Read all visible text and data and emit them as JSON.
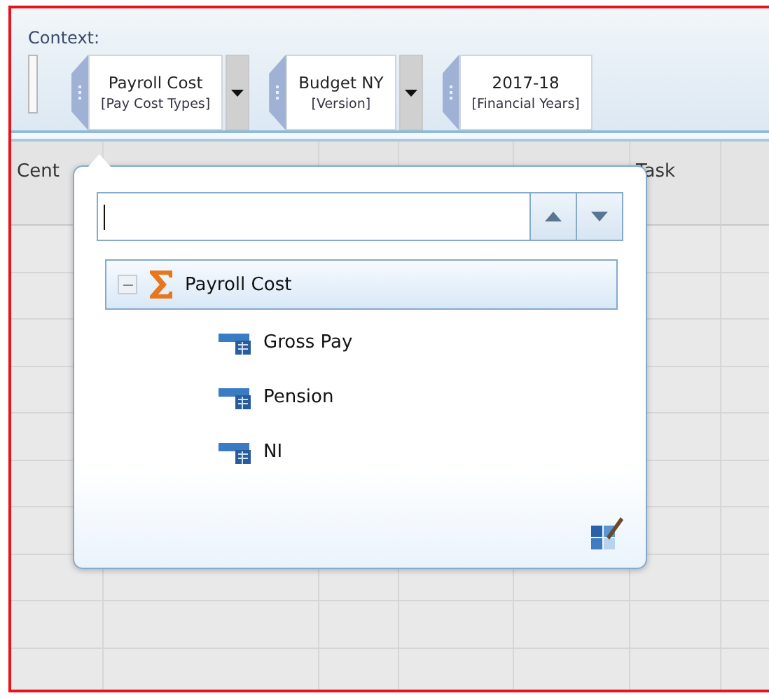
{
  "context": {
    "label": "Context:",
    "selectors": [
      {
        "value": "Payroll Cost",
        "dimension": "[Pay Cost Types]",
        "has_dropdown": true
      },
      {
        "value": "Budget NY",
        "dimension": "[Version]",
        "has_dropdown": true
      },
      {
        "value": "2017-18",
        "dimension": "[Financial Years]",
        "has_dropdown": false
      }
    ]
  },
  "grid": {
    "columns": [
      {
        "label": "Cent"
      },
      {},
      {},
      {},
      {},
      {
        "label": "Task"
      },
      {}
    ]
  },
  "popup": {
    "search": {
      "focused": true
    },
    "tree": [
      {
        "label": "Payroll Cost",
        "kind": "rollup",
        "expanded": true,
        "selected": true,
        "children": [
          {
            "label": "Gross Pay",
            "kind": "member",
            "selected": false
          },
          {
            "label": "Pension",
            "kind": "member",
            "selected": false
          },
          {
            "label": "NI",
            "kind": "member",
            "selected": false
          }
        ]
      }
    ]
  }
}
